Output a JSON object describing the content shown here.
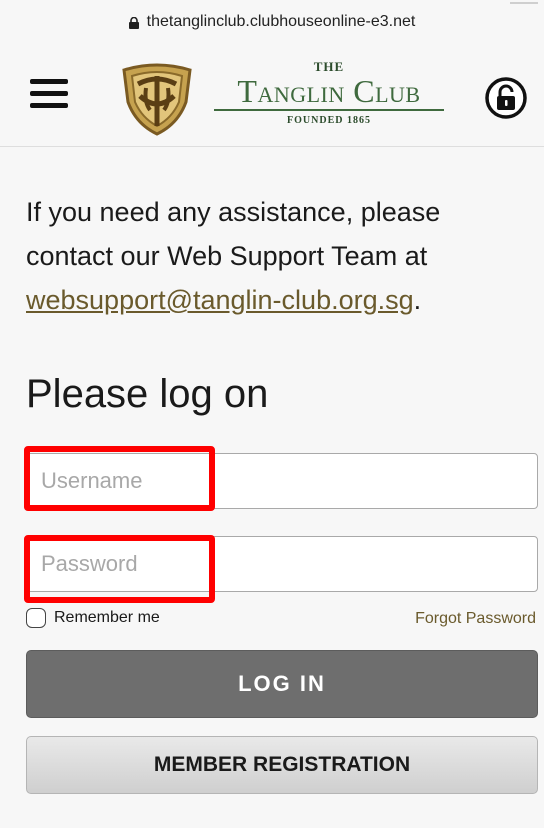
{
  "browser": {
    "url": "thetanglinclub.clubhouseonline-e3.net"
  },
  "header": {
    "logo": {
      "the": "THE",
      "name": "Tanglin Club",
      "founded": "FOUNDED 1865"
    }
  },
  "info": {
    "text": "If you need any assistance, please contact our Web Support Team at ",
    "email": "websupport@tanglin-club.org.sg",
    "suffix": "."
  },
  "login": {
    "heading": "Please log on",
    "username_placeholder": "Username",
    "password_placeholder": "Password",
    "remember_label": "Remember me",
    "forgot_label": "Forgot Password",
    "login_button": "LOG IN",
    "register_button": "MEMBER REGISTRATION"
  },
  "colors": {
    "brand_green": "#3f6a3e",
    "link_brown": "#6a5a2c",
    "highlight_red": "#ff0000",
    "login_button_bg": "#6e6e6e"
  }
}
